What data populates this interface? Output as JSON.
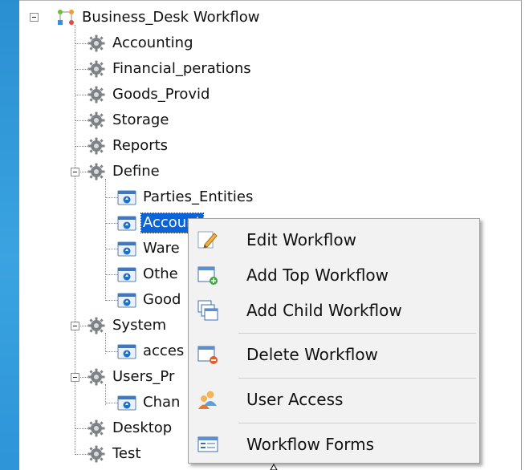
{
  "tree": {
    "root": "Business_Desk Workflow",
    "nodes": [
      "Accounting",
      "Financial_perations",
      "Goods_Provid",
      "Storage",
      "Reports",
      "Define",
      "Parties_Entities",
      "Account",
      "Ware",
      "Othe",
      "Good",
      "System",
      "acces",
      "Users_Pr",
      "Chan",
      "Desktop",
      "Test"
    ],
    "selected": "Account"
  },
  "context_menu": {
    "items": [
      {
        "label": "Edit Workflow",
        "icon": "edit-pencil-icon"
      },
      {
        "label": "Add Top Workflow",
        "icon": "add-top-workflow-icon"
      },
      {
        "label": "Add Child Workflow",
        "icon": "add-child-workflow-icon"
      },
      {
        "label": "Delete Workflow",
        "icon": "delete-workflow-icon"
      },
      {
        "label": "User Access",
        "icon": "user-access-icon"
      },
      {
        "label": "Workflow Forms",
        "icon": "workflow-forms-icon"
      }
    ]
  },
  "colors": {
    "selection": "#0a64d8",
    "left_strip": "#2a8fd1",
    "menu_background": "#f2f2f2"
  }
}
